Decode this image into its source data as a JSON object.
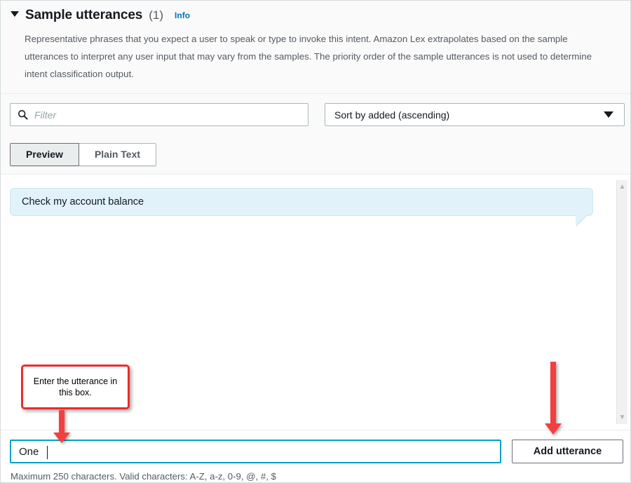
{
  "section": {
    "caret_icon": "caret-down-icon",
    "title": "Sample utterances",
    "count": "(1)",
    "info_link": "Info",
    "description": "Representative phrases that you expect a user to speak or type to invoke this intent. Amazon Lex extrapolates based on the sample utterances to interpret any user input that may vary from the samples. The priority order of the sample utterances is not used to determine intent classification output."
  },
  "toolbar": {
    "search_icon": "search-icon",
    "filter_value": "",
    "filter_placeholder": "Filter",
    "sort_selected": "Sort by added (ascending)",
    "sort_caret_icon": "caret-down-icon",
    "sort_options": [
      "Sort by added (ascending)"
    ]
  },
  "tabs": [
    {
      "label": "Preview",
      "active": true
    },
    {
      "label": "Plain Text",
      "active": false
    }
  ],
  "preview": {
    "utterances": [
      "Check my account balance"
    ],
    "scroll_up_icon": "chevron-up-icon",
    "scroll_down_icon": "chevron-down-icon"
  },
  "input_row": {
    "utterance_value": "One",
    "utterance_placeholder": "",
    "add_button_label": "Add utterance",
    "helper_text": "Maximum 250 characters. Valid characters: A-Z, a-z, 0-9, @, #, $"
  },
  "annotations": {
    "callout_text": "Enter the utterance in this box.",
    "arrow_left_icon": "arrow-down-icon",
    "arrow_right_icon": "arrow-down-icon"
  },
  "colors": {
    "accent_blue": "#0073bb",
    "focus_blue": "#00a1c9",
    "bubble_bg": "#e1f2fb",
    "annotation_red": "#ed2b2b",
    "text_primary": "#16191f",
    "text_secondary": "#545b64"
  }
}
